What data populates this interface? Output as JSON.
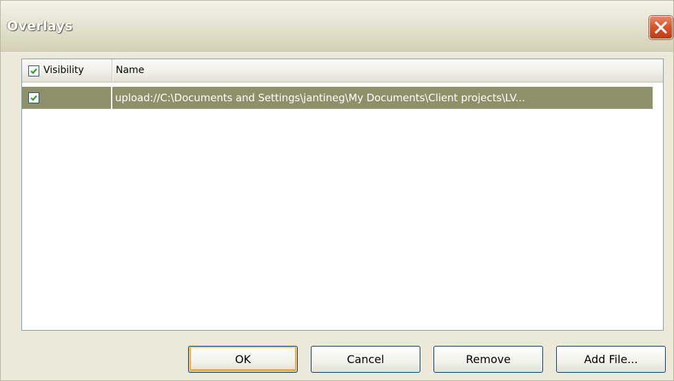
{
  "window": {
    "title": "Overlays",
    "close_icon": "close-icon"
  },
  "list": {
    "columns": [
      {
        "label": "Visibility",
        "checked": true
      },
      {
        "label": "Name"
      }
    ],
    "rows": [
      {
        "visible": true,
        "name": "upload://C:\\Documents and Settings\\jantineg\\My Documents\\Client projects\\LV...",
        "selected": true
      }
    ]
  },
  "buttons": {
    "ok": "OK",
    "cancel": "Cancel",
    "remove": "Remove",
    "add_file": "Add File..."
  },
  "colors": {
    "selection": "#8f8f69",
    "dialog_bg": "#ece9d8",
    "checkmark": "#21a121",
    "close_red": "#d9552c"
  }
}
